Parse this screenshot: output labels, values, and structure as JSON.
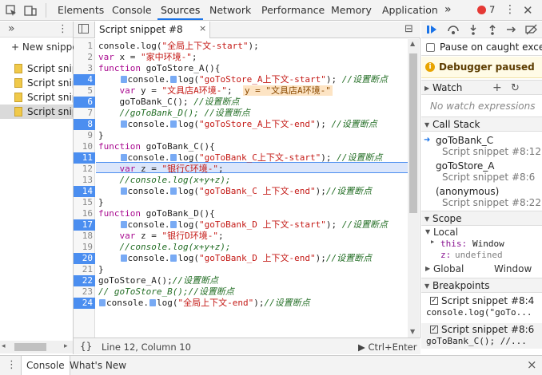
{
  "toolbar": {
    "tabs": [
      "Elements",
      "Console",
      "Sources",
      "Network",
      "Performance",
      "Memory",
      "Application"
    ],
    "more": "»",
    "error_count": "7",
    "menu": "⋮"
  },
  "navigator": {
    "new_snippet": "+ New snippet",
    "snippets": [
      "Script snippet #",
      "Script snippet #",
      "Script snippet #",
      "Script snippet #"
    ]
  },
  "editor": {
    "tab_label": "Script snippet #8",
    "lines": [
      {
        "n": "1",
        "code": "console.log(\"全局上下文-start\");"
      },
      {
        "n": "2",
        "code": "var x = \"家中环境-\";"
      },
      {
        "n": "3",
        "code": "function goToStore_A(){"
      },
      {
        "n": "4",
        "code": "    console.log(\"goToStore_A上下文-start\"); //设置断点"
      },
      {
        "n": "5",
        "code": "    var y = \"文具店A环境-\";"
      },
      {
        "n": "6",
        "code": "    goToBank_C(); //设置断点"
      },
      {
        "n": "7",
        "code": "    //goToBank_D(); //设置断点"
      },
      {
        "n": "8",
        "code": "    console.log(\"goToStore_A上下文-end\"); //设置断点"
      },
      {
        "n": "9",
        "code": "}"
      },
      {
        "n": "10",
        "code": "function goToBank_C(){"
      },
      {
        "n": "11",
        "code": "    console.log(\"goToBank_C上下文-start\"); //设置断点"
      },
      {
        "n": "12",
        "code": "    var z = \"银行C环境-\";"
      },
      {
        "n": "13",
        "code": "    //console.log(x+y+z);"
      },
      {
        "n": "14",
        "code": "    console.log(\"goToBank_C 上下文-end\");//设置断点"
      },
      {
        "n": "15",
        "code": "}"
      },
      {
        "n": "16",
        "code": "function goToBank_D(){"
      },
      {
        "n": "17",
        "code": "    console.log(\"goToBank_D 上下文-start\"); //设置断点"
      },
      {
        "n": "18",
        "code": "    var z = \"银行D环境-\";"
      },
      {
        "n": "19",
        "code": "    //console.log(x+y+z);"
      },
      {
        "n": "20",
        "code": "    console.log(\"goToBank_D 上下文-end\");//设置断点"
      },
      {
        "n": "21",
        "code": "}"
      },
      {
        "n": "22",
        "code": "goToStore_A();//设置断点"
      },
      {
        "n": "23",
        "code": "// goToStore_B();//设置断点"
      },
      {
        "n": "24",
        "code": "console.log(\"全局上下文-end\");//设置断点"
      }
    ],
    "inline_value": "y = \"文具店A环境-\"",
    "status_position": "Line 12, Column 10",
    "run_hint": "▶ Ctrl+Enter"
  },
  "debugger": {
    "pause_caught": "Pause on caught exce...",
    "paused_label": "Debugger paused",
    "watch": {
      "title": "Watch",
      "empty": "No watch expressions"
    },
    "call_stack": {
      "title": "Call Stack",
      "frames": [
        {
          "name": "goToBank_C",
          "loc": "Script snippet #8:12"
        },
        {
          "name": "goToStore_A",
          "loc": "Script snippet #8:6"
        },
        {
          "name": "(anonymous)",
          "loc": "Script snippet #8:22"
        }
      ]
    },
    "scope": {
      "title": "Scope",
      "local": "Local",
      "this_key": "this:",
      "this_val": "Window",
      "z_key": "z:",
      "z_val": "undefined",
      "global": "Global",
      "global_val": "Window"
    },
    "breakpoints": {
      "title": "Breakpoints",
      "items": [
        {
          "label": "Script snippet #8:4",
          "code": "console.log(\"goTo..."
        },
        {
          "label": "Script snippet #8:6",
          "code": "goToBank_C(); //..."
        }
      ]
    }
  },
  "drawer": {
    "tabs": [
      "Console",
      "What's New"
    ],
    "close": "×"
  },
  "colors": {
    "accent": "#1a73e8",
    "breakpoint": "#4b8ef0",
    "paused_bg": "#fffbe6"
  }
}
